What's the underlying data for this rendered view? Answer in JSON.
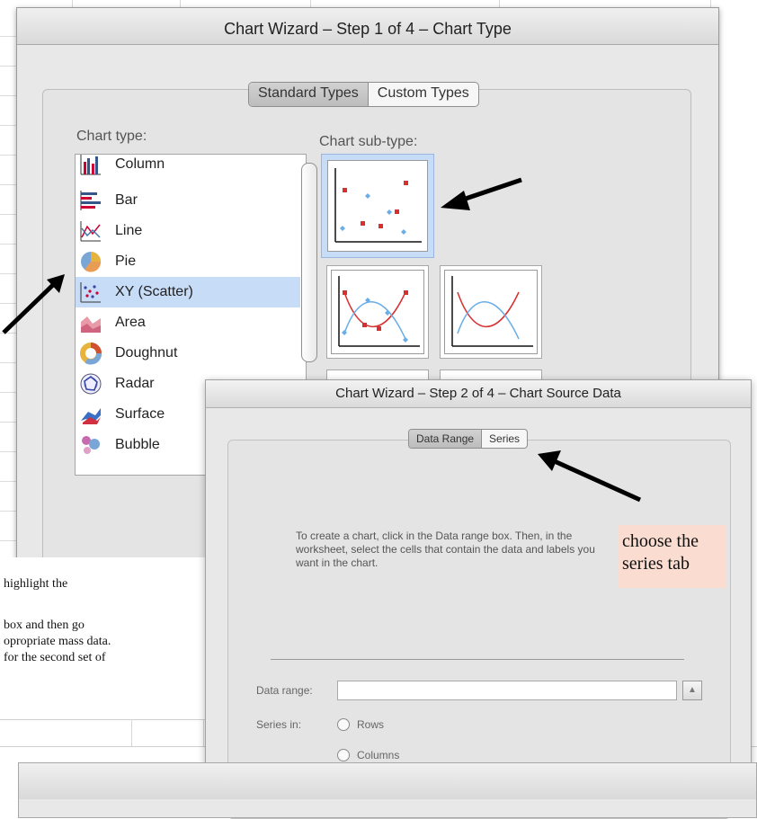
{
  "wizard1": {
    "title": "Chart Wizard – Step 1 of 4 – Chart Type",
    "tabs": [
      "Standard Types",
      "Custom Types"
    ],
    "chart_type_label": "Chart type:",
    "chart_subtype_label": "Chart sub-type:",
    "chart_types": [
      {
        "label": "Column",
        "icon": "column-chart-icon"
      },
      {
        "label": "Bar",
        "icon": "bar-chart-icon"
      },
      {
        "label": "Line",
        "icon": "line-chart-icon"
      },
      {
        "label": "Pie",
        "icon": "pie-chart-icon"
      },
      {
        "label": "XY (Scatter)",
        "icon": "scatter-chart-icon",
        "selected": true
      },
      {
        "label": "Area",
        "icon": "area-chart-icon"
      },
      {
        "label": "Doughnut",
        "icon": "doughnut-chart-icon"
      },
      {
        "label": "Radar",
        "icon": "radar-chart-icon"
      },
      {
        "label": "Surface",
        "icon": "surface-chart-icon"
      },
      {
        "label": "Bubble",
        "icon": "bubble-chart-icon"
      }
    ]
  },
  "wizard2": {
    "title": "Chart Wizard – Step 2 of 4 – Chart Source Data",
    "tabs": [
      "Data Range",
      "Series"
    ],
    "instructions": "To create a chart, click in the Data range box. Then, in the worksheet, select the cells that contain the data and labels you want in the chart.",
    "data_range_label": "Data range:",
    "data_range_value": "",
    "series_in_label": "Series in:",
    "series_options": [
      "Rows",
      "Columns"
    ]
  },
  "annotations": {
    "choose_series_line1": "choose the",
    "choose_series_line2": "series tab",
    "left_note_lines": [
      "highlight the",
      "box and then go",
      "opropriate mass data.",
      "for the second set of"
    ]
  },
  "colors": {
    "selection": "#c7dcf6",
    "highlight_note": "#fadcd0",
    "series_red": "#d63030",
    "series_blue": "#6aaee8"
  }
}
